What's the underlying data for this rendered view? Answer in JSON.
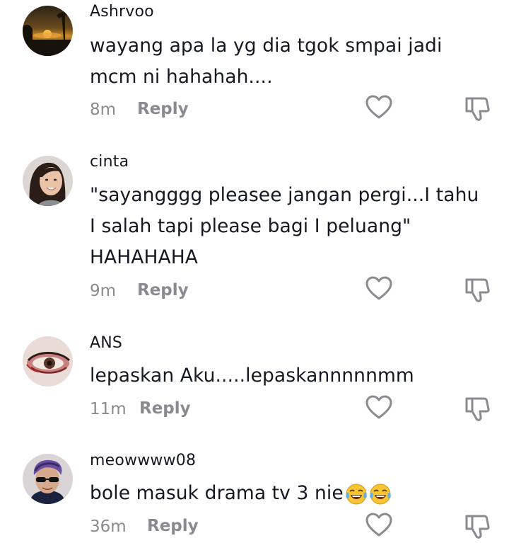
{
  "comments": [
    {
      "username": "Ashrvoo",
      "lines": [
        "wayang apa la yg dia tgok smpai jadi",
        "mcm ni hahahah...."
      ],
      "time": "8m",
      "reply_label": "Reply",
      "avatar_icon": "sunset-photo-avatar"
    },
    {
      "username": "cinta",
      "lines": [
        "\"sayangggg pleasee jangan pergi...I tahu",
        "I salah tapi please bagi I peluang\"",
        "HAHAHAHA"
      ],
      "time": "9m",
      "reply_label": "Reply",
      "avatar_icon": "woman-photo-avatar"
    },
    {
      "username": "ANS",
      "lines": [
        "lepaskan Aku.....lepaskannnnnmm"
      ],
      "time": "11m",
      "reply_label": "Reply",
      "avatar_icon": "eye-photo-avatar"
    },
    {
      "username": "meowwww08",
      "lines": [
        "bole masuk drama tv 3 nie"
      ],
      "emoji": [
        "tears-of-joy-emoji",
        "tears-of-joy-emoji"
      ],
      "time": "36m",
      "reply_label": "Reply",
      "avatar_icon": "man-sunglasses-avatar"
    }
  ],
  "icons": {
    "like": "heart-outline-icon",
    "dislike": "thumbs-down-icon"
  },
  "colors": {
    "text": "#161823",
    "secondary": "#8a8b91",
    "background": "#ffffff"
  }
}
